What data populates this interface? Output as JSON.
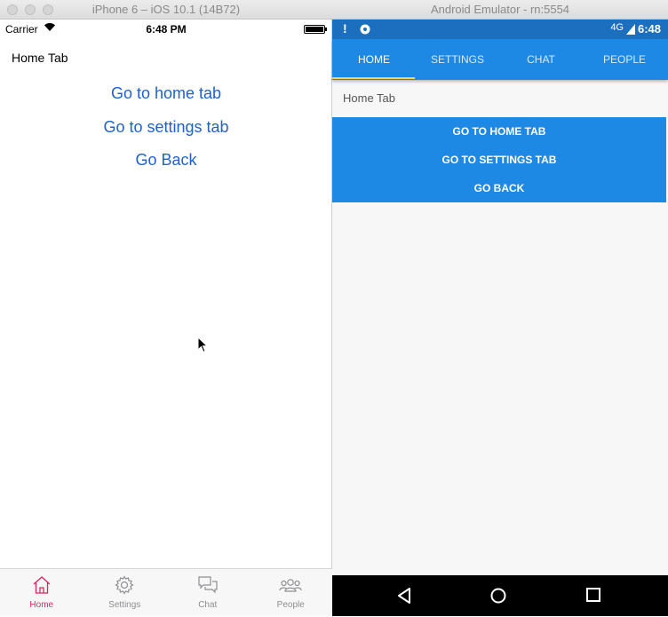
{
  "ios": {
    "window_title": "iPhone 6 – iOS 10.1 (14B72)",
    "status": {
      "carrier": "Carrier",
      "time": "6:48 PM"
    },
    "heading": "Home Tab",
    "links": [
      "Go to home tab",
      "Go to settings tab",
      "Go Back"
    ],
    "tabs": [
      {
        "label": "Home",
        "icon": "home-icon",
        "active": true
      },
      {
        "label": "Settings",
        "icon": "gear-icon",
        "active": false
      },
      {
        "label": "Chat",
        "icon": "chat-icon",
        "active": false
      },
      {
        "label": "People",
        "icon": "people-icon",
        "active": false
      }
    ],
    "colors": {
      "link": "#1e62d0",
      "active_tab": "#e0245e",
      "inactive_tab": "#8e8e93"
    }
  },
  "android": {
    "window_title": "Android Emulator - rn:5554",
    "status": {
      "time": "6:48",
      "network": "4G"
    },
    "tabs": [
      {
        "label": "HOME",
        "active": true
      },
      {
        "label": "SETTINGS",
        "active": false
      },
      {
        "label": "CHAT",
        "active": false
      },
      {
        "label": "PEOPLE",
        "active": false
      }
    ],
    "heading": "Home Tab",
    "buttons": [
      "GO TO HOME TAB",
      "GO TO SETTINGS TAB",
      "GO BACK"
    ],
    "nav": [
      "back-icon",
      "home-circle-icon",
      "recents-icon"
    ],
    "colors": {
      "primary": "#1e88e5",
      "status_bar": "#1c6fbf",
      "indicator": "#f4d35a"
    }
  }
}
